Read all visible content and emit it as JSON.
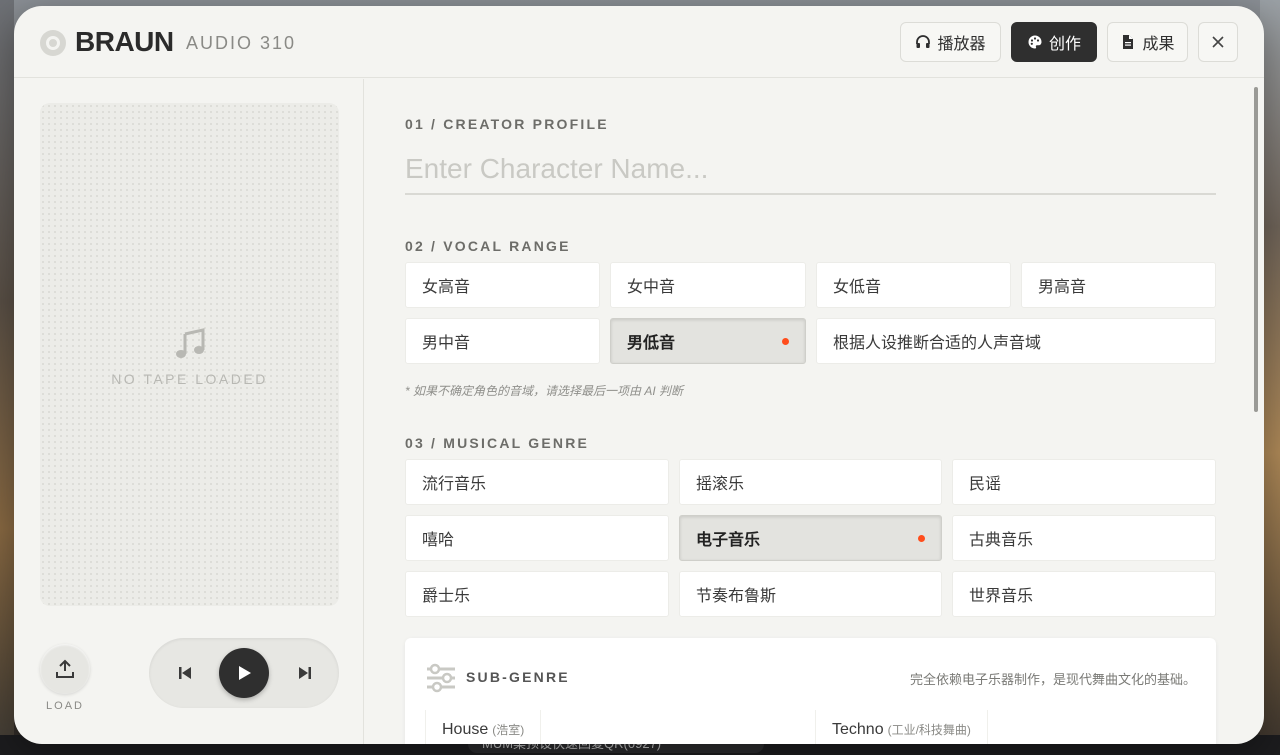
{
  "header": {
    "brand": "BRAUN",
    "model": "AUDIO 310",
    "tabs": [
      {
        "label": "播放器",
        "icon": "headphones-icon"
      },
      {
        "label": "创作",
        "icon": "palette-icon",
        "active": true
      },
      {
        "label": "成果",
        "icon": "document-icon"
      }
    ]
  },
  "sidebar": {
    "tape_label": "NO TAPE LOADED",
    "load_label": "LOAD"
  },
  "profile": {
    "title": "01 / CREATOR PROFILE",
    "name_placeholder": "Enter Character Name..."
  },
  "vocal": {
    "title": "02 / VOCAL RANGE",
    "options": [
      "女高音",
      "女中音",
      "女低音",
      "男高音",
      "男中音",
      "男低音",
      "根据人设推断合适的人声音域"
    ],
    "selected": "男低音",
    "hint": "* 如果不确定角色的音域，请选择最后一项由 AI 判断"
  },
  "genre": {
    "title": "03 / MUSICAL GENRE",
    "options": [
      "流行音乐",
      "摇滚乐",
      "民谣",
      "嘻哈",
      "电子音乐",
      "古典音乐",
      "爵士乐",
      "节奏布鲁斯",
      "世界音乐"
    ],
    "selected": "电子音乐"
  },
  "subgenre": {
    "title": "SUB-GENRE",
    "description": "完全依赖电子乐器制作，是现代舞曲文化的基础。",
    "items": [
      {
        "name": "House",
        "note": "(浩室)"
      },
      {
        "name": "Techno",
        "note": "(工业/科技舞曲)"
      }
    ]
  },
  "taskbar": {
    "text": "MUM桌预设快速回复QR(0927)"
  },
  "colors": {
    "accent": "#ff4d1c",
    "dark": "#2f2f2f",
    "panel": "#f4f4f1"
  }
}
